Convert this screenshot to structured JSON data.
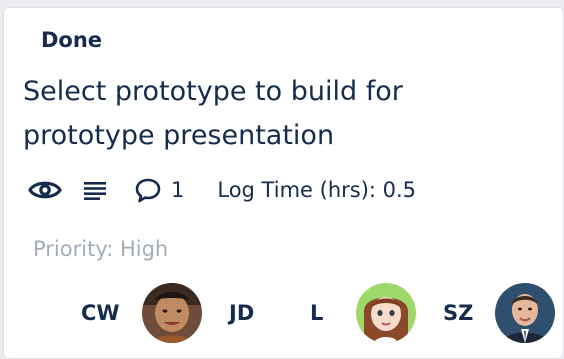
{
  "card": {
    "status": "Done",
    "title": "Select prototype to build for prototype presentation",
    "badges": {
      "watch_icon": "eye-icon",
      "description_icon": "description-lines-icon",
      "comment_icon": "speech-bubble-icon",
      "comment_count": "1",
      "log_time": "Log Time (hrs): 0.5"
    },
    "priority": "Priority: High",
    "members": [
      {
        "initials": "CW"
      },
      {
        "initials": "JD"
      },
      {
        "initials": "L"
      },
      {
        "initials": "SZ"
      }
    ]
  },
  "colors": {
    "text_primary": "#172b4d",
    "text_muted": "#a5adba",
    "card_background": "#ffffff",
    "board_background": "#ebecf0"
  }
}
